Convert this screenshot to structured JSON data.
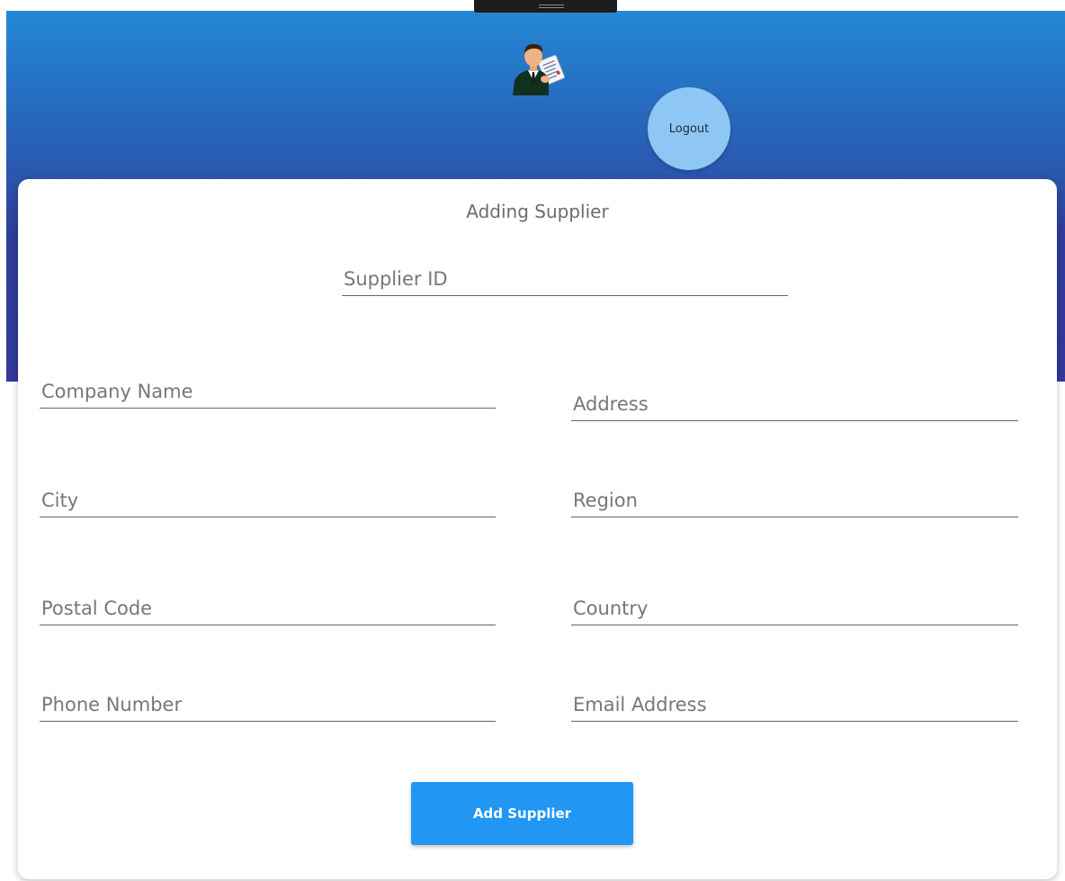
{
  "window": {
    "drag_handle_icon": "grip-lines-icon"
  },
  "header": {
    "avatar_icon": "businessman-with-document-icon",
    "logout_label": "Logout",
    "colors": {
      "gradient_top": "#2487d6",
      "gradient_bottom": "#34389a",
      "logout_bg": "#8fc7f4"
    }
  },
  "form": {
    "title": "Adding Supplier",
    "fields": {
      "supplier_id": {
        "placeholder": "Supplier ID",
        "value": ""
      },
      "company_name": {
        "placeholder": "Company Name",
        "value": ""
      },
      "address": {
        "placeholder": "Address",
        "value": ""
      },
      "city": {
        "placeholder": "City",
        "value": ""
      },
      "region": {
        "placeholder": "Region",
        "value": ""
      },
      "postal_code": {
        "placeholder": "Postal Code",
        "value": ""
      },
      "country": {
        "placeholder": "Country",
        "value": ""
      },
      "phone_number": {
        "placeholder": "Phone Number",
        "value": ""
      },
      "email_address": {
        "placeholder": "Email Address",
        "value": ""
      }
    },
    "submit_label": "Add Supplier",
    "colors": {
      "button": "#2196f3"
    }
  }
}
